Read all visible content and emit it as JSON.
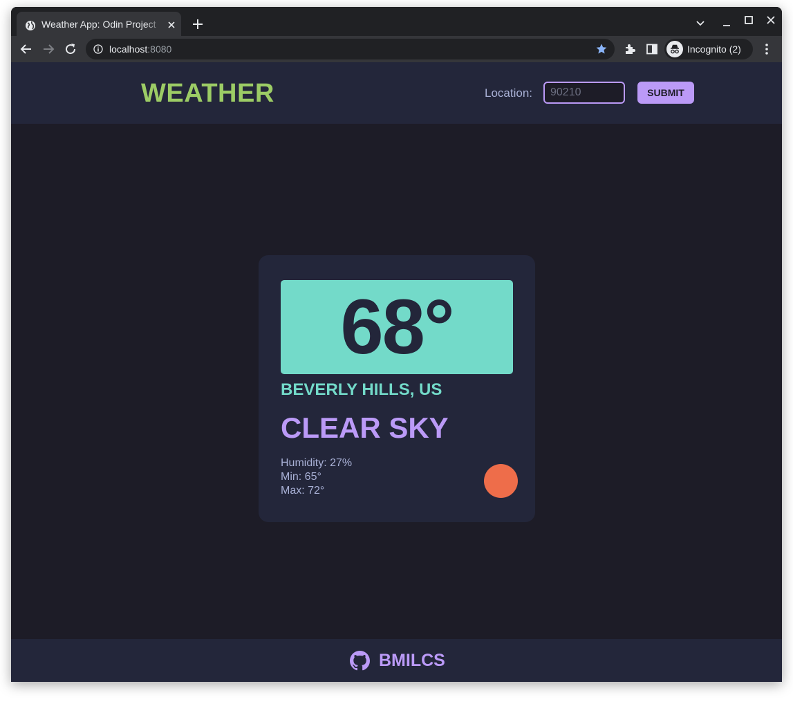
{
  "browser": {
    "tab_title": "Weather App: Odin Project",
    "url_host": "localhost",
    "url_port": ":8080",
    "profile_label": "Incognito (2)"
  },
  "header": {
    "logo": "WEATHER",
    "location_label": "Location:",
    "location_placeholder": "90210",
    "location_value": "",
    "submit_label": "SUBMIT"
  },
  "weather": {
    "temperature": "68°",
    "city": "BEVERLY HILLS, US",
    "condition": "CLEAR SKY",
    "humidity": "Humidity: 27%",
    "min": "Min: 65°",
    "max": "Max: 72°"
  },
  "footer": {
    "github_user": "BMILCS"
  },
  "colors": {
    "page_bg": "#1d1c27",
    "panel_bg": "#23263a",
    "logo_green": "#9ccc65",
    "accent_purple": "#bb9af7",
    "accent_teal": "#73dac9",
    "sun_orange": "#ee6d4a"
  }
}
